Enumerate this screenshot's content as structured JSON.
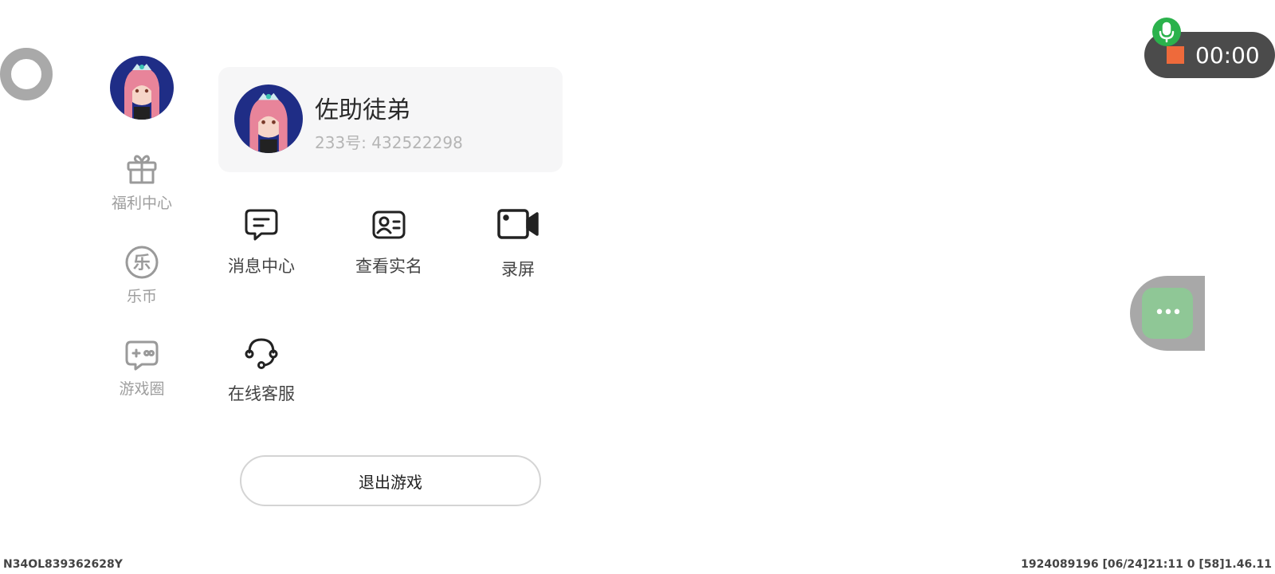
{
  "profile": {
    "name": "佐助徒弟",
    "uid_text": "233号: 432522298"
  },
  "rail": {
    "items": [
      {
        "label": "福利中心",
        "icon": "gift-icon"
      },
      {
        "label": "乐币",
        "icon": "coin-icon",
        "glyph": "乐"
      },
      {
        "label": "游戏圈",
        "icon": "gamepad-icon"
      }
    ]
  },
  "functions": [
    {
      "label": "消息中心",
      "icon": "message-icon"
    },
    {
      "label": "查看实名",
      "icon": "id-card-icon"
    },
    {
      "label": "录屏",
      "icon": "video-camera-icon"
    },
    {
      "label": "在线客服",
      "icon": "headset-icon"
    }
  ],
  "exit_button": {
    "label": "退出游戏"
  },
  "recorder": {
    "time": "00:00"
  },
  "footer": {
    "left": "N34OL839362628Y",
    "right": "1924089196   [06/24]21:11 0   [58]1.46.11"
  },
  "colors": {
    "record_stop": "#ee6a3b",
    "mic": "#2bb24c",
    "float_button": "#8fc796"
  }
}
